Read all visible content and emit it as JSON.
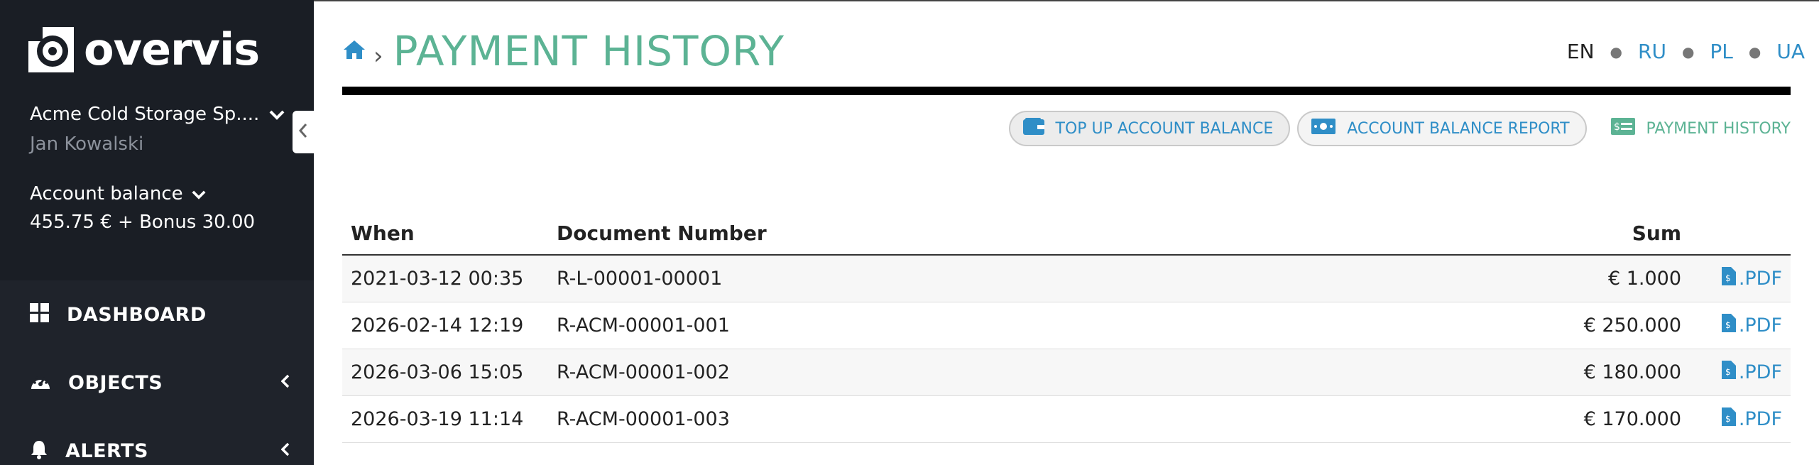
{
  "app": {
    "logo_text": "overvis"
  },
  "sidebar": {
    "company": "Acme Cold Storage Sp....",
    "user": "Jan Kowalski",
    "balance_label": "Account balance",
    "balance_value": "455.75 € + Bonus 30.00",
    "nav": [
      {
        "label": "DASHBOARD",
        "icon": "dashboard-icon"
      },
      {
        "label": "OBJECTS",
        "icon": "gauge-icon"
      },
      {
        "label": "ALERTS",
        "icon": "bell-icon"
      }
    ]
  },
  "header": {
    "title": "PAYMENT HISTORY",
    "languages": [
      "EN",
      "RU",
      "PL",
      "UA"
    ],
    "active_language": "EN"
  },
  "toolbar": {
    "top_up": "TOP UP ACCOUNT BALANCE",
    "report": "ACCOUNT BALANCE REPORT",
    "history": "PAYMENT HISTORY"
  },
  "table": {
    "columns": [
      "When",
      "Document Number",
      "Sum"
    ],
    "rows": [
      {
        "when": "2021-03-12 00:35",
        "doc": "R-L-00001-00001",
        "sum": "€ 1.000",
        "pdf": ".PDF"
      },
      {
        "when": "2026-02-14 12:19",
        "doc": "R-ACM-00001-001",
        "sum": "€ 250.000",
        "pdf": ".PDF"
      },
      {
        "when": "2026-03-06 15:05",
        "doc": "R-ACM-00001-002",
        "sum": "€ 180.000",
        "pdf": ".PDF"
      },
      {
        "when": "2026-03-19 11:14",
        "doc": "R-ACM-00001-003",
        "sum": "€ 170.000",
        "pdf": ".PDF"
      }
    ]
  },
  "colors": {
    "accent_green": "#5cb394",
    "link_blue": "#2f8ec7",
    "sidebar_bg": "#1f232b"
  }
}
